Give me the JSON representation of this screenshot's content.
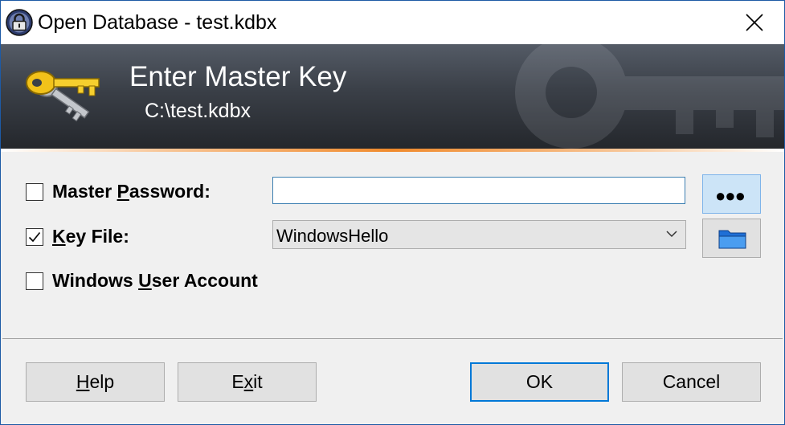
{
  "window": {
    "title": "Open Database - test.kdbx"
  },
  "banner": {
    "title": "Enter Master Key",
    "subtitle": "C:\\test.kdbx"
  },
  "form": {
    "master_password": {
      "label_pre": "Master ",
      "label_accel": "P",
      "label_post": "assword:",
      "checked": false,
      "value": "",
      "placeholder": ""
    },
    "key_file": {
      "label_pre": "",
      "label_accel": "K",
      "label_post": "ey File:",
      "checked": true,
      "selected": "WindowsHello"
    },
    "windows_user_account": {
      "label_pre": "Windows ",
      "label_accel": "U",
      "label_post": "ser Account",
      "checked": false
    },
    "show_password_glyph": "●●●"
  },
  "buttons": {
    "help": {
      "accel": "H",
      "rest": "elp"
    },
    "exit": {
      "pre": "E",
      "accel": "x",
      "post": "it"
    },
    "ok": "OK",
    "cancel": "Cancel"
  },
  "icons": {
    "app": "padlock-icon",
    "banner": "keys-icon",
    "browse": "folder-icon",
    "close": "close-icon",
    "dropdown": "chevron-down-icon",
    "check": "checkmark-icon"
  },
  "colors": {
    "accent": "#0078d7",
    "banner_line": "#f08a2c",
    "title_border": "#1d5aa5"
  }
}
